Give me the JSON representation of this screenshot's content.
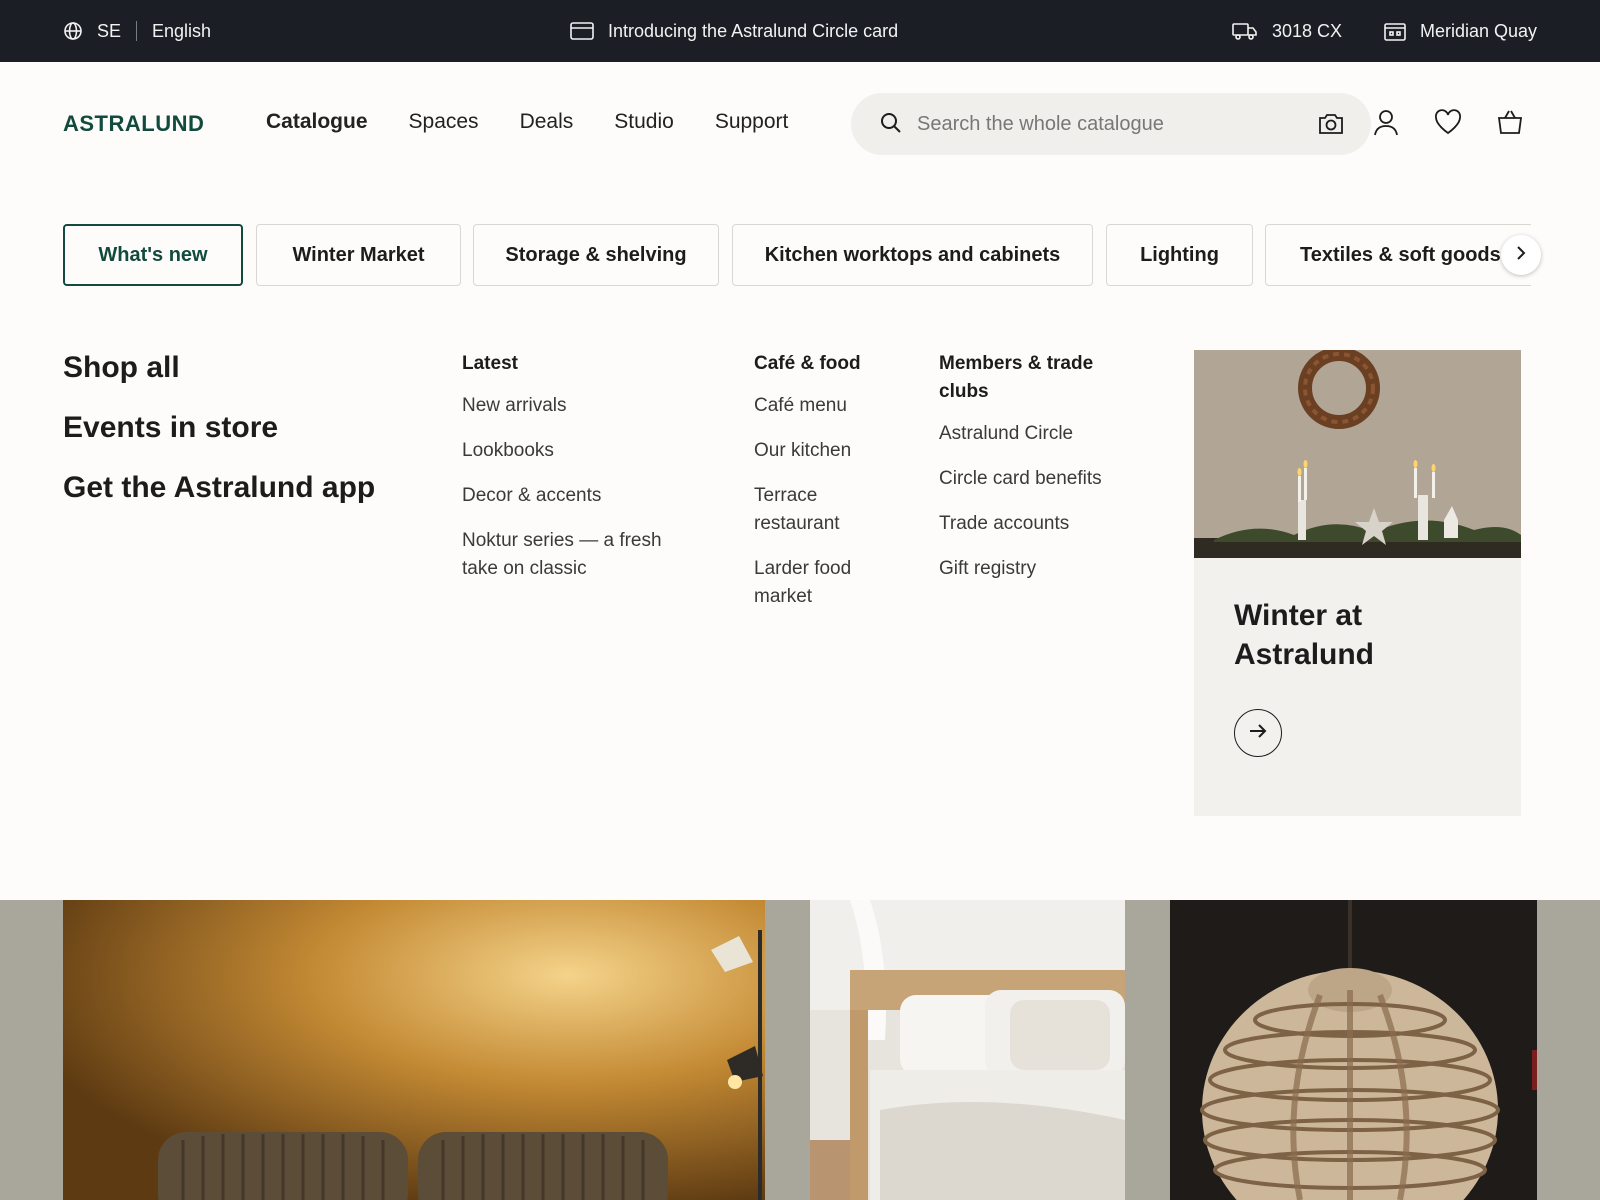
{
  "topbar": {
    "country": "SE",
    "language": "English",
    "promo": "Introducing the Astralund Circle card",
    "postcode": "3018 CX",
    "store": "Meridian Quay"
  },
  "header": {
    "logo": "ASTRALUND",
    "nav": [
      "Catalogue",
      "Spaces",
      "Deals",
      "Studio",
      "Support"
    ],
    "active_nav": "Catalogue",
    "search_placeholder": "Search the whole catalogue"
  },
  "pills": [
    "What's new",
    "Winter Market",
    "Storage & shelving",
    "Kitchen worktops and cabinets",
    "Lighting",
    "Textiles & soft goods"
  ],
  "active_pill": "What's new",
  "menu": {
    "big_links": [
      "Shop all",
      "Events in store",
      "Get the Astralund app"
    ],
    "latest": {
      "title": "Latest",
      "links": [
        "New arrivals",
        "Lookbooks",
        "Decor & accents",
        "Noktur series — a fresh take on classic"
      ]
    },
    "cafe": {
      "title": "Café & food",
      "links": [
        "Café menu",
        "Our kitchen",
        "Terrace restaurant",
        "Larder food market"
      ]
    },
    "members": {
      "title": "Members & trade clubs",
      "links": [
        "Astralund Circle",
        "Circle card benefits",
        "Trade accounts",
        "Gift registry"
      ]
    }
  },
  "promo_card": {
    "title": "Winter at Astralund"
  },
  "colors": {
    "brand_green": "#124a3e",
    "topbar_bg": "#1b1e24",
    "page_bg": "#fdfcfa"
  }
}
